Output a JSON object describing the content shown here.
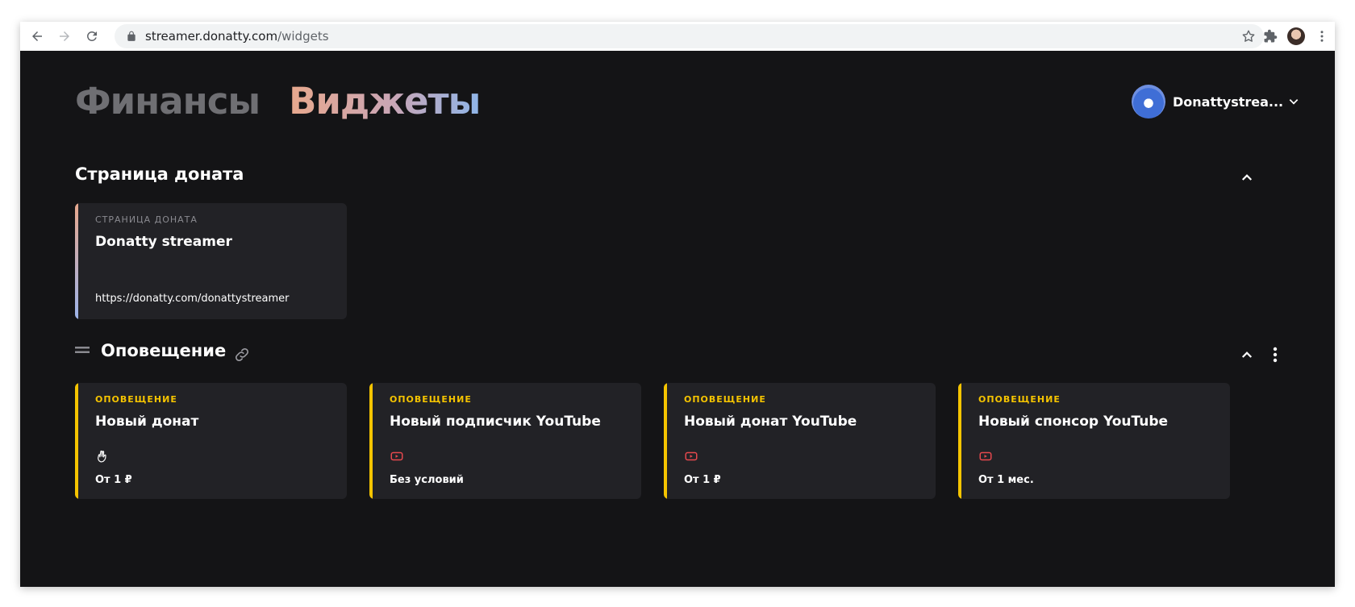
{
  "browser": {
    "url_host": "streamer.donatty.com",
    "url_path": "/widgets"
  },
  "nav": {
    "tabs": [
      {
        "label": "Финансы",
        "active": false
      },
      {
        "label": "Виджеты",
        "active": true
      }
    ]
  },
  "user": {
    "name": "Donattystrea..."
  },
  "sections": {
    "donation_page": {
      "title": "Страница доната",
      "card": {
        "eyebrow": "СТРАНИЦА ДОНАТА",
        "title": "Donatty streamer",
        "link": "https://donatty.com/donattystreamer"
      }
    },
    "alerts": {
      "title": "Оповещение",
      "cards": [
        {
          "eyebrow": "ОПОВЕЩЕНИЕ",
          "title": "Новый донат",
          "icon": "donatty-hand-icon",
          "meta": "От 1 ₽"
        },
        {
          "eyebrow": "ОПОВЕЩЕНИЕ",
          "title": "Новый подписчик YouTube",
          "icon": "youtube-icon",
          "meta": "Без условий"
        },
        {
          "eyebrow": "ОПОВЕЩЕНИЕ",
          "title": "Новый донат YouTube",
          "icon": "youtube-icon",
          "meta": "От 1 ₽"
        },
        {
          "eyebrow": "ОПОВЕЩЕНИЕ",
          "title": "Новый спонсор YouTube",
          "icon": "youtube-icon",
          "meta": "От 1 мес."
        }
      ]
    }
  },
  "colors": {
    "background": "#141416",
    "card": "#222226",
    "alert_accent": "#f5c400",
    "youtube_red": "#e5484d"
  }
}
